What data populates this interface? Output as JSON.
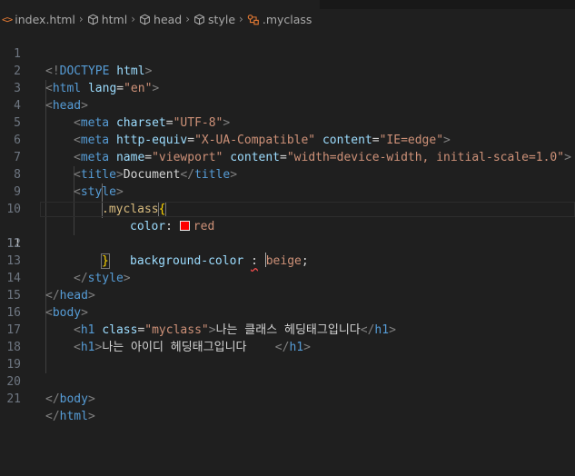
{
  "breadcrumb": {
    "items": [
      {
        "icon": "html-file-icon",
        "label": "index.html"
      },
      {
        "icon": "element-cube-icon",
        "label": "html"
      },
      {
        "icon": "element-cube-icon",
        "label": "head"
      },
      {
        "icon": "element-cube-icon",
        "label": "style"
      },
      {
        "icon": "css-selector-symbol-icon",
        "label": ".myclass"
      }
    ],
    "html_icon_glyph": "<>"
  },
  "editor": {
    "active_line": 11,
    "line_numbers": [
      "1",
      "2",
      "3",
      "4",
      "5",
      "6",
      "7",
      "8",
      "9",
      "10",
      "11",
      "12",
      "13",
      "14",
      "15",
      "16",
      "17",
      "18",
      "19",
      "20",
      "21"
    ],
    "lines": {
      "l1": [
        "<!",
        "DOCTYPE",
        " ",
        "html",
        ">"
      ],
      "l2": [
        "<",
        "html",
        " ",
        "lang",
        "=",
        "\"en\"",
        ">"
      ],
      "l3": [
        "<",
        "head",
        ">"
      ],
      "l4": [
        "<",
        "meta",
        " ",
        "charset",
        "=",
        "\"UTF-8\"",
        ">"
      ],
      "l5": [
        "<",
        "meta",
        " ",
        "http-equiv",
        "=",
        "\"X-UA-Compatible\"",
        " ",
        "content",
        "=",
        "\"IE=edge\"",
        ">"
      ],
      "l6": [
        "<",
        "meta",
        " ",
        "name",
        "=",
        "\"viewport\"",
        " ",
        "content",
        "=",
        "\"width=device-width, initial-scale=1.0\"",
        ">"
      ],
      "l7": [
        "<",
        "title",
        ">",
        "Document",
        "</",
        "title",
        ">"
      ],
      "l8": [
        "<",
        "style",
        ">"
      ],
      "l9": [
        ".myclass",
        "{"
      ],
      "l10": [
        "color",
        ": ",
        "red"
      ],
      "l11": [
        "background-color",
        " ",
        ":",
        " ",
        "b",
        "eige",
        ";"
      ],
      "l12": [
        "}"
      ],
      "l13": [
        "</",
        "style",
        ">"
      ],
      "l14": [
        "</",
        "head",
        ">"
      ],
      "l15": [
        "<",
        "body",
        ">"
      ],
      "l16": [
        "<",
        "h1",
        " ",
        "class",
        "=",
        "\"myclass\"",
        ">",
        "나는 클래스 헤딩태그입니다",
        "</",
        "h1",
        ">"
      ],
      "l17": [
        "<",
        "h1",
        ">",
        "나는 아이디 헤딩태그입니다    ",
        "</",
        "h1",
        ">"
      ],
      "l20": [
        "</",
        "body",
        ">"
      ],
      "l21": [
        "</",
        "html",
        ">"
      ]
    }
  },
  "colors": {
    "background": "#1f1f1f",
    "tag": "#569cd6",
    "attribute": "#9cdcfe",
    "string": "#ce9178",
    "selector": "#d7ba7d",
    "bracket_highlight": "#ffd700",
    "color_swatch": "#ff0000",
    "error_squiggle": "#f14c4c"
  }
}
